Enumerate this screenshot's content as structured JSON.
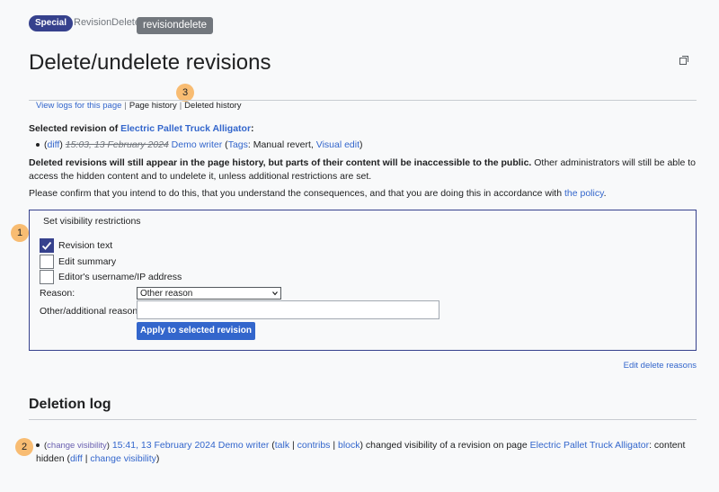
{
  "header": {
    "namespace_badge": "Special",
    "breadcrumb": "RevisionDelete",
    "page_name_badge": "revisiondelete",
    "title": "Delete/undelete revisions"
  },
  "toplinks": {
    "view_logs": "View logs for this page",
    "page_history": "Page history",
    "deleted_history": "Deleted history"
  },
  "markers": [
    "1",
    "2",
    "3"
  ],
  "selected": {
    "label_prefix": "Selected revision of ",
    "page_link": "Electric Pallet Truck Alligator",
    "label_suffix": ":",
    "diff": "diff",
    "timestamp": "15:03, 13 February 2024",
    "user": "Demo writer",
    "tags_label": "Tags",
    "tags_value": ": Manual revert, ",
    "visual_edit": "Visual edit"
  },
  "paragraphs": {
    "warning_bold": "Deleted revisions will still appear in the page history, but parts of their content will be inaccessible to the public.",
    "warning_rest": " Other administrators will still be able to access the hidden content and to undelete it, unless additional restrictions are set.",
    "confirm": "Please confirm that you intend to do this, that you understand the consequences, and that you are doing this in accordance with ",
    "policy_link": "the policy",
    "confirm_end": "."
  },
  "form": {
    "legend": "Set visibility restrictions",
    "checkboxes": [
      {
        "label": "Revision text",
        "checked": true
      },
      {
        "label": "Edit summary",
        "checked": false
      },
      {
        "label": "Editor's username/IP address",
        "checked": false
      }
    ],
    "reason_label": "Reason:",
    "reason_selected": "Other reason",
    "other_reason_label": "Other/additional reason:",
    "other_reason_value": "",
    "submit": "Apply to selected revision",
    "edit_reasons": "Edit delete reasons"
  },
  "deletion_log": {
    "title": "Deletion log",
    "change_visibility": "change visibility",
    "timestamp": "15:41, 13 February 2024",
    "user": "Demo writer",
    "talk": "talk",
    "contribs": "contribs",
    "block": "block",
    "action_text": " changed visibility of a revision on page ",
    "page_link": "Electric Pallet Truck Alligator",
    "result": ": content hidden (",
    "diff": "diff",
    "change_visibility_2": "change visibility"
  },
  "colors": {
    "accent": "#36418d",
    "link": "#3366cc",
    "marker": "#f8bc72"
  }
}
